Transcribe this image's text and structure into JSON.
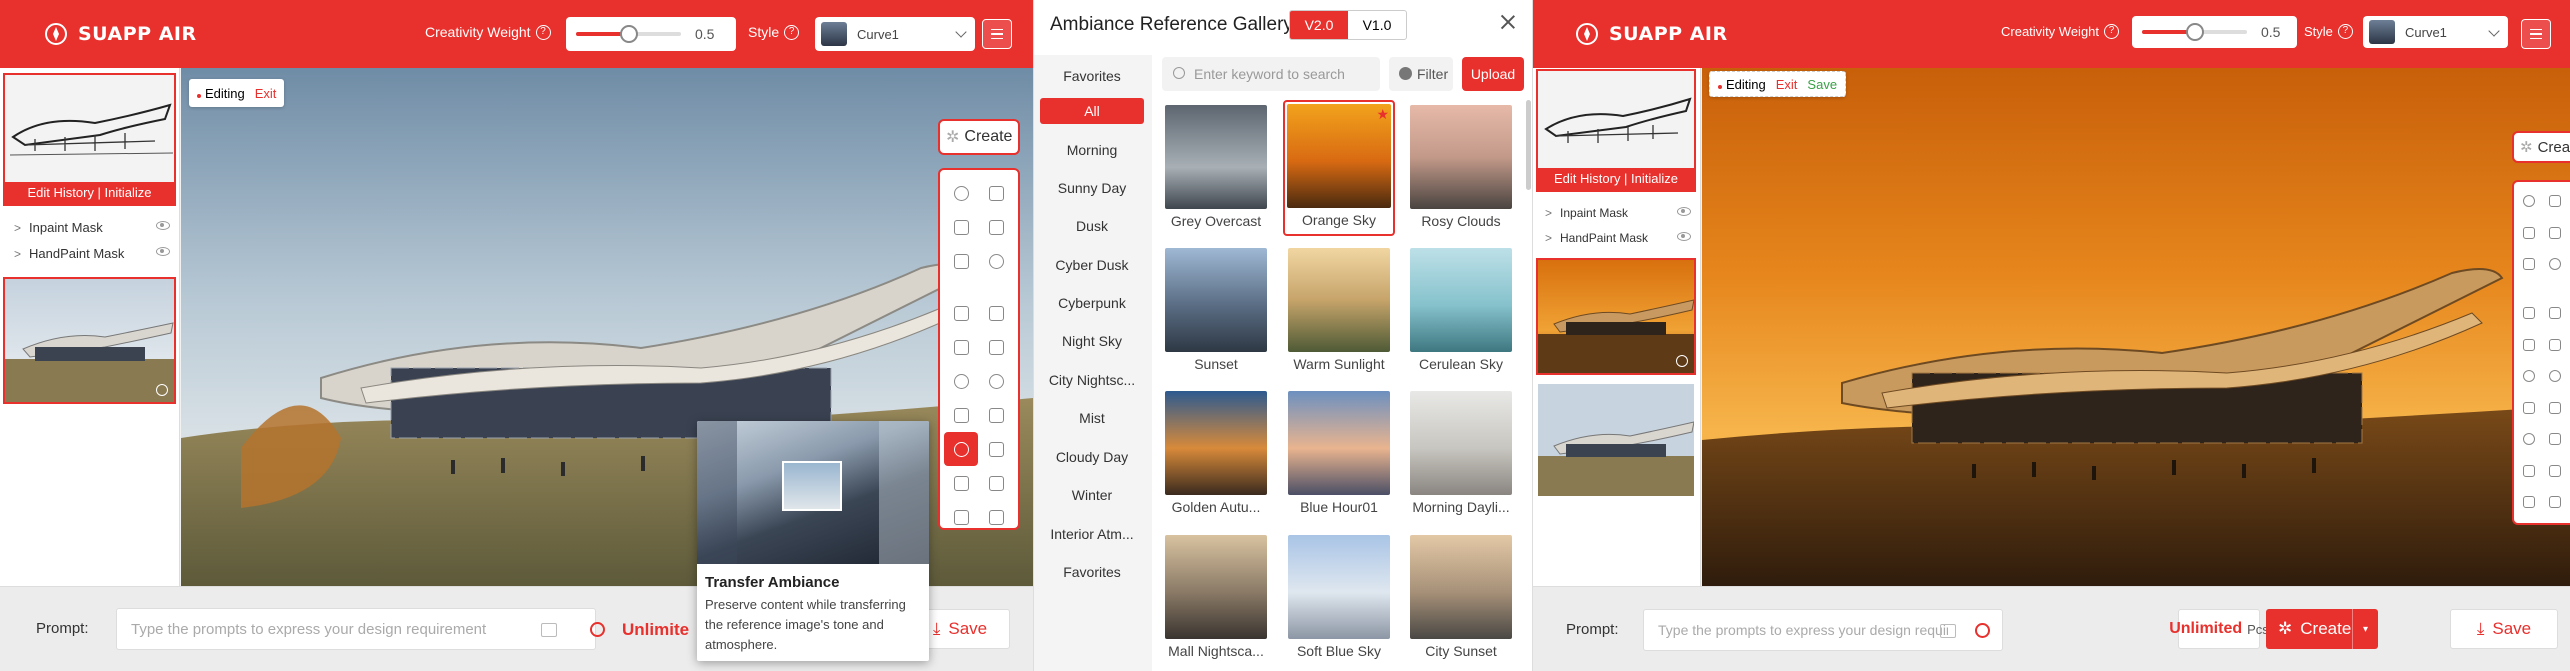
{
  "left": {
    "brand": "SUAPP AIR",
    "creativity_label": "Creativity Weight",
    "creativity_value": "0.5",
    "creativity_fraction": 0.5,
    "style_label": "Style",
    "style_value": "Curve1",
    "history_caption": "Edit History | Initialize",
    "layers": [
      "Inpaint Mask",
      "HandPaint Mask"
    ],
    "editing": "Editing",
    "exit": "Exit",
    "create": "Create",
    "prompt_label": "Prompt:",
    "prompt_placeholder": "Type the prompts to express your design requirement",
    "unlimited": "Unlimite",
    "save": "Save",
    "tooltip_title": "Transfer Ambiance",
    "tooltip_desc": "Preserve content while transferring the reference image's tone and atmosphere."
  },
  "gallery": {
    "title": "Ambiance Reference Gallery",
    "versions": [
      "V2.0",
      "V1.0"
    ],
    "categories": [
      "Favorites",
      "All",
      "Morning",
      "Sunny Day",
      "Dusk",
      "Cyber Dusk",
      "Cyberpunk",
      "Night Sky",
      "City Nightsc...",
      "Mist",
      "Cloudy Day",
      "Winter",
      "Interior Atm...",
      "Favorites"
    ],
    "search_placeholder": "Enter keyword to search",
    "filter": "Filter",
    "upload": "Upload",
    "items": [
      {
        "name": "Grey Overcast"
      },
      {
        "name": "Orange Sky"
      },
      {
        "name": "Rosy Clouds"
      },
      {
        "name": "Sunset"
      },
      {
        "name": "Warm Sunlight"
      },
      {
        "name": "Cerulean Sky"
      },
      {
        "name": "Golden Autu..."
      },
      {
        "name": "Blue Hour01"
      },
      {
        "name": "Morning Dayli..."
      },
      {
        "name": "Mall Nightsca..."
      },
      {
        "name": "Soft Blue Sky"
      },
      {
        "name": "City Sunset"
      }
    ]
  },
  "right": {
    "brand": "SUAPP AIR",
    "creativity_label": "Creativity Weight",
    "creativity_value": "0.5",
    "creativity_fraction": 0.5,
    "style_label": "Style",
    "style_value": "Curve1",
    "history_caption": "Edit History | Initialize",
    "layers": [
      "Inpaint Mask",
      "HandPaint Mask"
    ],
    "editing": "Editing",
    "exit": "Exit",
    "save_badge": "Save",
    "create": "Create",
    "prompt_label": "Prompt:",
    "prompt_placeholder": "Type the prompts to express your design requirement",
    "unlimited": "Unlimited",
    "pcs": "Pcs",
    "create_button": "Create",
    "save": "Save"
  },
  "colors": {
    "accent": "#e8302d"
  }
}
